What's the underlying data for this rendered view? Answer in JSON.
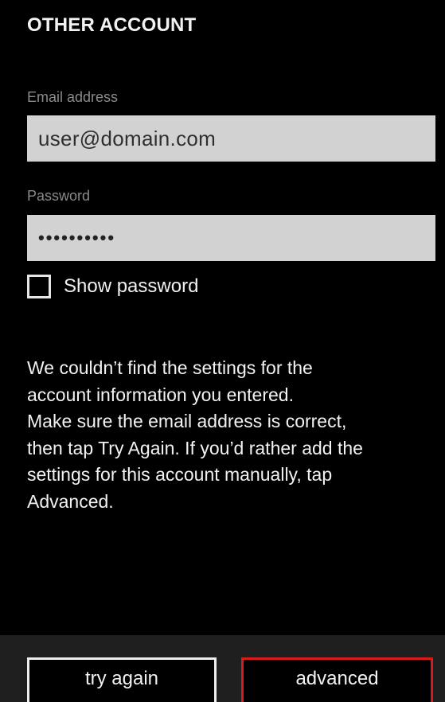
{
  "page": {
    "title": "OTHER ACCOUNT"
  },
  "email": {
    "label": "Email address",
    "value": "user@domain.com"
  },
  "password": {
    "label": "Password",
    "masked_value": "••••••••••"
  },
  "show_password": {
    "label": "Show password",
    "checked": false
  },
  "message": {
    "line1": "We couldn’t find the settings for the",
    "line2": "account information you entered.",
    "line3": "Make sure the email address is correct,",
    "line4": "then tap Try Again. If you’d rather add the",
    "line5": "settings for this account manually, tap",
    "line6": "Advanced."
  },
  "buttons": {
    "try_again": "try again",
    "advanced": "advanced"
  },
  "colors": {
    "background": "#000000",
    "input_background": "#d2d2d2",
    "accent_red": "#d81a1a"
  }
}
